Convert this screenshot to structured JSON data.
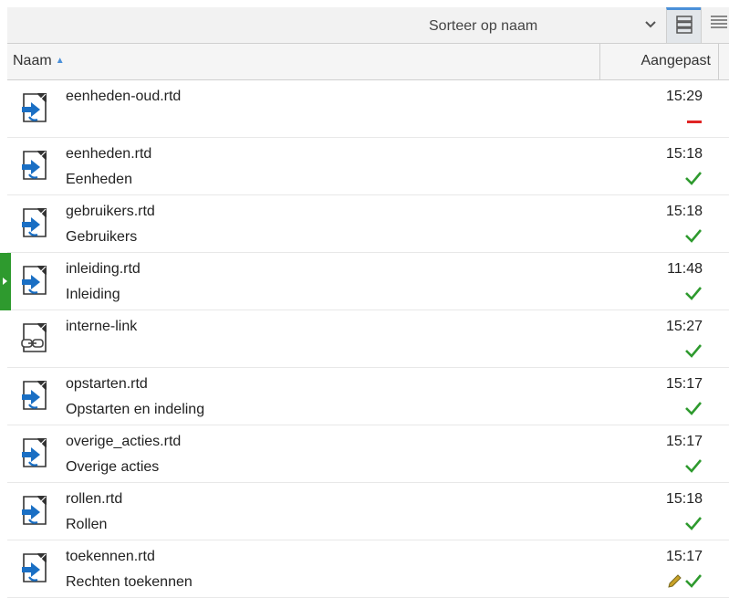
{
  "toolbar": {
    "sort_label": "Sorteer op naam",
    "sort_chevron_icon": "chevron-down-icon",
    "view_list_icon": "list-view-icon",
    "view_detail_icon": "detail-view-icon"
  },
  "columns": {
    "name": "Naam",
    "modified": "Aangepast",
    "sort_direction": "ascending"
  },
  "colors": {
    "accent": "#4a90d9",
    "ok": "#2e9a2e",
    "error": "#e02424",
    "edit": "#c9a227"
  },
  "rows": [
    {
      "filename": "eenheden-oud.rtd",
      "title": "",
      "time": "15:29",
      "icon": "document-arrow-icon",
      "status": "error",
      "selected": false
    },
    {
      "filename": "eenheden.rtd",
      "title": "Eenheden",
      "time": "15:18",
      "icon": "document-arrow-icon",
      "status": "ok",
      "selected": false
    },
    {
      "filename": "gebruikers.rtd",
      "title": "Gebruikers",
      "time": "15:18",
      "icon": "document-arrow-icon",
      "status": "ok",
      "selected": false
    },
    {
      "filename": "inleiding.rtd",
      "title": "Inleiding",
      "time": "11:48",
      "icon": "document-arrow-icon",
      "status": "ok",
      "selected": true
    },
    {
      "filename": "interne-link",
      "title": "",
      "time": "15:27",
      "icon": "document-link-icon",
      "status": "ok",
      "selected": false
    },
    {
      "filename": "opstarten.rtd",
      "title": "Opstarten en indeling",
      "time": "15:17",
      "icon": "document-arrow-icon",
      "status": "ok",
      "selected": false
    },
    {
      "filename": "overige_acties.rtd",
      "title": "Overige acties",
      "time": "15:17",
      "icon": "document-arrow-icon",
      "status": "ok",
      "selected": false
    },
    {
      "filename": "rollen.rtd",
      "title": "Rollen",
      "time": "15:18",
      "icon": "document-arrow-icon",
      "status": "ok",
      "selected": false
    },
    {
      "filename": "toekennen.rtd",
      "title": "Rechten toekennen",
      "time": "15:17",
      "icon": "document-arrow-icon",
      "status": "edit-ok",
      "selected": false
    }
  ]
}
